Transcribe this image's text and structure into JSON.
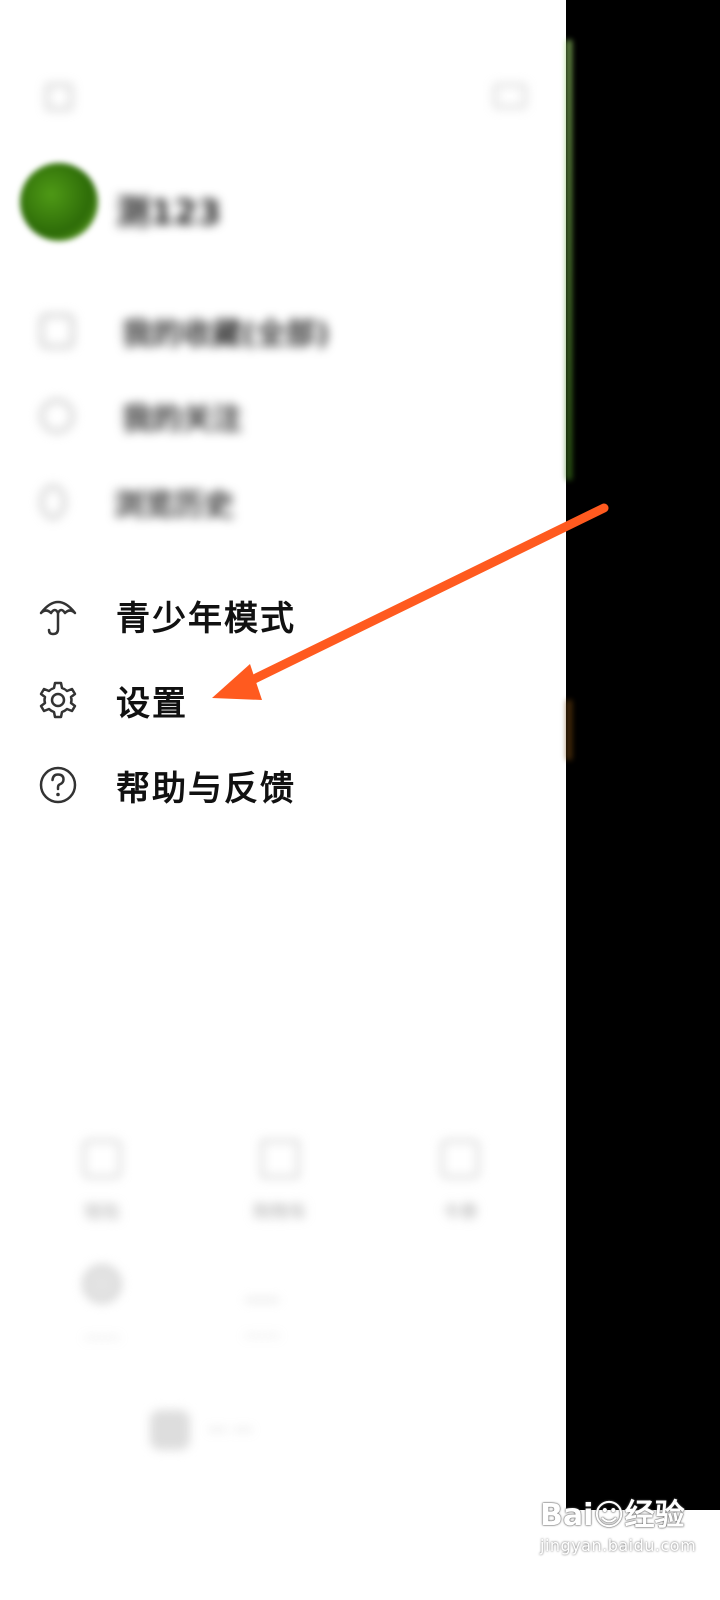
{
  "profile": {
    "username": "测123"
  },
  "blurred_items": [
    {
      "label": "我的收藏(全部)"
    },
    {
      "label": "我的关注"
    },
    {
      "label": "浏览历史"
    }
  ],
  "menu": {
    "youth_mode": "青少年模式",
    "settings": "设置",
    "help_feedback": "帮助与反馈"
  },
  "bottom_tiles": [
    {
      "icon": "yuan-icon",
      "label": "钱包"
    },
    {
      "icon": "cart-icon",
      "label": "购物车"
    },
    {
      "icon": "coupon-icon",
      "label": "卡券"
    },
    {
      "icon": "circle-icon",
      "label": "……"
    },
    {
      "icon": "shield-icon",
      "label": "……"
    }
  ],
  "watermark": {
    "brand": "Bai☺经验",
    "url": "jingyan.baidu.com"
  },
  "colors": {
    "arrow": "#ff5a1f",
    "accent_green": "#4f9a16",
    "side_panel": "#000000"
  }
}
